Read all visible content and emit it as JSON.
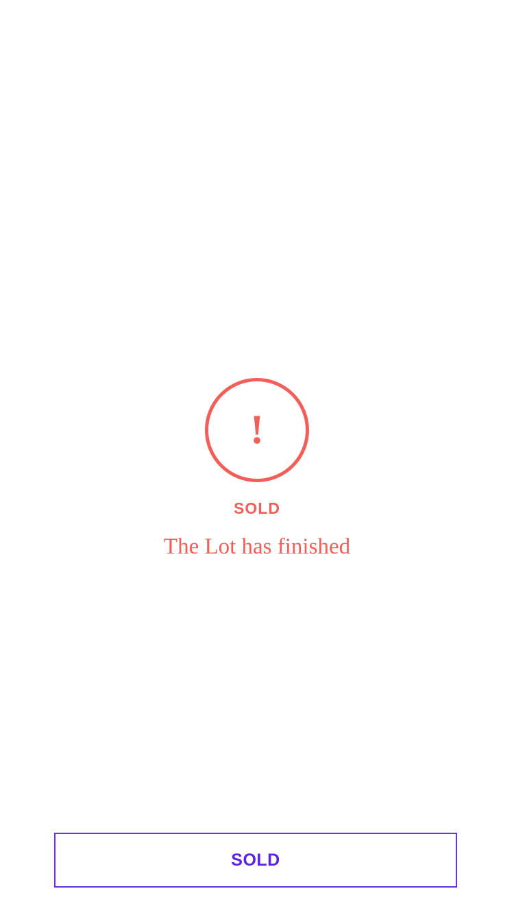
{
  "alert": {
    "icon_glyph": "!",
    "icon_name": "exclamation-circle-icon",
    "status_label": "SOLD",
    "message": "The Lot has finished"
  },
  "footer": {
    "button_label": "SOLD"
  },
  "colors": {
    "alert": "#f15f5a",
    "button_border": "#6a2ee8",
    "button_text": "#5b21e6",
    "background": "#ffffff"
  }
}
